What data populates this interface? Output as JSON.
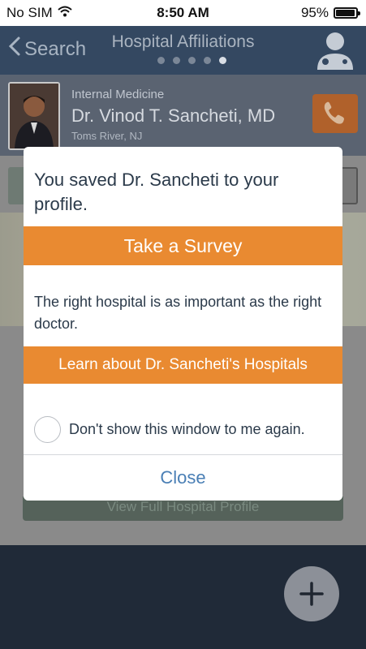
{
  "status_bar": {
    "carrier": "No SIM",
    "time": "8:50 AM",
    "battery": "95%",
    "battery_level": 0.95
  },
  "nav": {
    "back_label": "Search",
    "title": "Hospital Affiliations",
    "page_dots": 5,
    "active_dot": 4
  },
  "doctor": {
    "specialty": "Internal Medicine",
    "name": "Dr. Vinod T. Sancheti, MD",
    "location": "Toms River, NJ"
  },
  "background": {
    "button_label": "View Full Hospital Profile"
  },
  "modal": {
    "title": "You saved Dr. Sancheti to your profile.",
    "survey_label": "Take a Survey",
    "message": "The right hospital is as important as the right doctor.",
    "learn_label": "Learn about Dr. Sancheti's Hospitals",
    "checkbox_label": "Don't show this window to me again.",
    "close_label": "Close"
  },
  "colors": {
    "accent_orange": "#e98a31",
    "link_blue": "#4a7fb5",
    "nav_bg": "#344861"
  }
}
